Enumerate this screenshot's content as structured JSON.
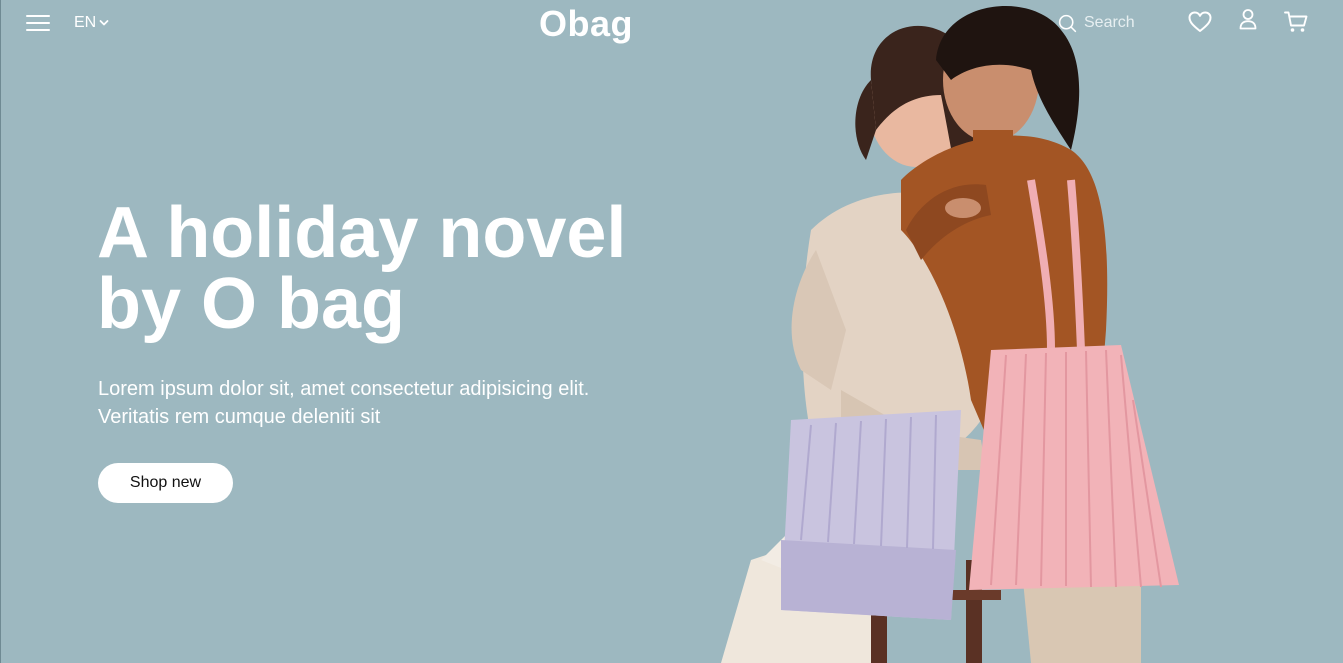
{
  "header": {
    "menu_icon": "hamburger-menu-icon",
    "language": "EN",
    "logo": "Obag",
    "search_placeholder": "Search",
    "icons": [
      "search-icon",
      "heart-icon",
      "user-icon",
      "cart-icon"
    ]
  },
  "hero": {
    "title_line1": "A holiday novel",
    "title_line2": "by O bag",
    "desc_line1": "Lorem ipsum dolor sit, amet consectetur adipisicing elit.",
    "desc_line2": "Veritatis rem cumque deleniti sit",
    "cta_label": "Shop new",
    "background_color": "#9db8c0",
    "bag_colors": [
      "#c7c3df",
      "#f0aeb3"
    ]
  }
}
